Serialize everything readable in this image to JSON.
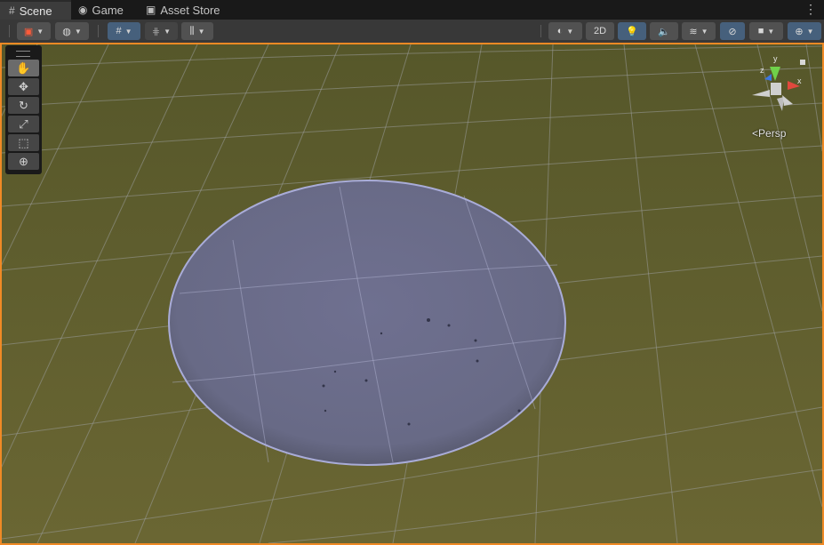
{
  "tabs": [
    {
      "label": "Scene",
      "icon": "grid-icon",
      "active": true
    },
    {
      "label": "Game",
      "icon": "gamepad-icon",
      "active": false
    },
    {
      "label": "Asset Store",
      "icon": "shopping-bag-icon",
      "active": false
    }
  ],
  "tab_menu": "⋮",
  "toolbar": {
    "button_2d_label": "2D"
  },
  "tools": [
    {
      "name": "hand-tool",
      "icon": "hand-icon",
      "glyph": "✋"
    },
    {
      "name": "move-tool",
      "icon": "move-icon",
      "glyph": "✥"
    },
    {
      "name": "rotate-tool",
      "icon": "rotate-icon",
      "glyph": "↻"
    },
    {
      "name": "scale-tool",
      "icon": "scale-icon",
      "glyph": "⤢"
    },
    {
      "name": "rect-tool",
      "icon": "rect-icon",
      "glyph": "⬚"
    },
    {
      "name": "transform-tool",
      "icon": "transform-icon",
      "glyph": "⊕"
    }
  ],
  "gizmo": {
    "axis_x": "x",
    "axis_y": "y",
    "axis_z": "z",
    "projection_label": "Persp"
  },
  "colors": {
    "accent_border": "#f08a25",
    "active_toggle": "#46607c",
    "ground": "#636230",
    "plane": "#6b6d88"
  }
}
